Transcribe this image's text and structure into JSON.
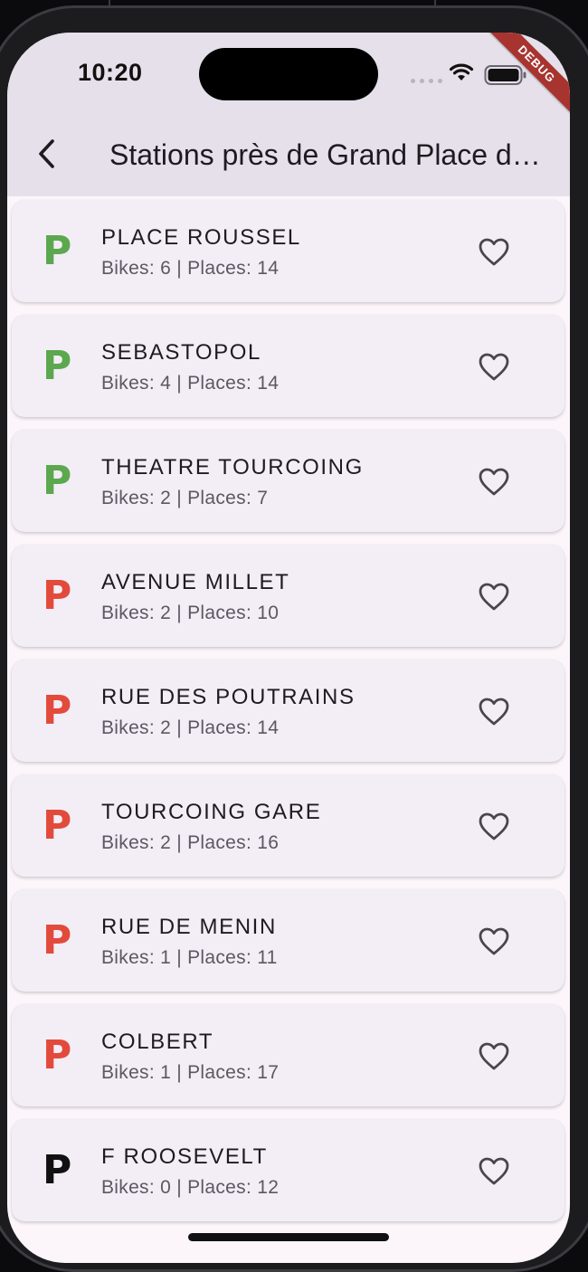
{
  "status_bar": {
    "time": "10:20",
    "debug_label": "DEBUG"
  },
  "app_bar": {
    "back_icon": "chevron-left-icon",
    "title": "Stations près de Grand Place de Tourcoing"
  },
  "colors": {
    "available": "#5ba84f",
    "low": "#e24b3b",
    "empty": "#111111",
    "appbar": "#e6e0eb",
    "card": "#f3edf6"
  },
  "stations": [
    {
      "name": "PLACE ROUSSEL",
      "info": "Bikes: 6 | Places: 14",
      "icon": "P",
      "status": "available"
    },
    {
      "name": "SEBASTOPOL",
      "info": "Bikes: 4 | Places: 14",
      "icon": "P",
      "status": "available"
    },
    {
      "name": "THEATRE TOURCOING",
      "info": "Bikes: 2 | Places: 7",
      "icon": "P",
      "status": "available"
    },
    {
      "name": "AVENUE MILLET",
      "info": "Bikes: 2 | Places: 10",
      "icon": "P",
      "status": "low"
    },
    {
      "name": "RUE DES POUTRAINS",
      "info": "Bikes: 2 | Places: 14",
      "icon": "P",
      "status": "low"
    },
    {
      "name": "TOURCOING GARE",
      "info": "Bikes: 2 | Places: 16",
      "icon": "P",
      "status": "low"
    },
    {
      "name": "RUE DE MENIN",
      "info": "Bikes: 1 | Places: 11",
      "icon": "P",
      "status": "low"
    },
    {
      "name": "COLBERT",
      "info": "Bikes: 1 | Places: 17",
      "icon": "P",
      "status": "low"
    },
    {
      "name": "F ROOSEVELT",
      "info": "Bikes: 0 | Places: 12",
      "icon": "P",
      "status": "empty"
    }
  ]
}
